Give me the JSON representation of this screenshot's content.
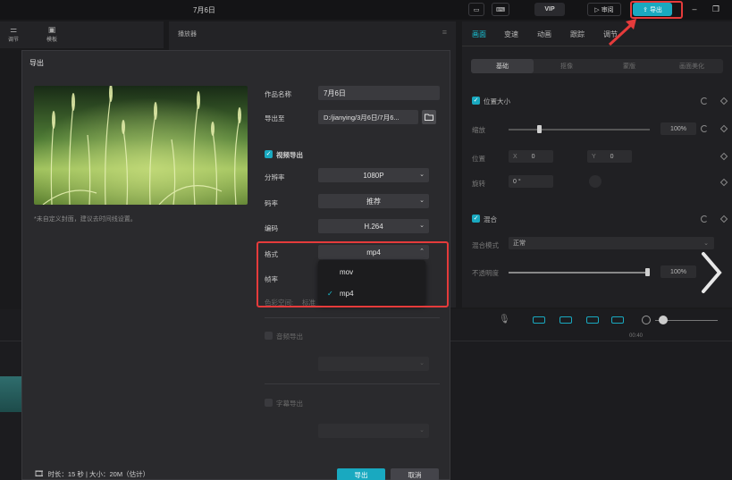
{
  "app": {
    "title": "7月6日",
    "topbar": {
      "review_label": "审阅",
      "export_label": "导出",
      "vip_label": "VIP"
    }
  },
  "left_panel": {
    "items": [
      "调节",
      "模板"
    ]
  },
  "player": {
    "title": "播放器"
  },
  "right_panel": {
    "tabs": [
      "画面",
      "变速",
      "动画",
      "跟踪",
      "调节"
    ],
    "active_tab": "画面",
    "subtabs": [
      "基础",
      "抠像",
      "蒙版",
      "画面美化"
    ],
    "position_size_label": "位置大小",
    "scale_label": "缩放",
    "scale_value": "100%",
    "position_label": "位置",
    "position_x_label": "X",
    "position_x": "0",
    "position_y_label": "Y",
    "position_y": "0",
    "rotate_label": "旋转",
    "rotate_value": "0 °",
    "blend_label": "混合",
    "blend_mode_label": "混合模式",
    "blend_mode_value": "正常",
    "opacity_label": "不透明度",
    "opacity_value": "100%"
  },
  "timeline": {
    "time_label": "00:40"
  },
  "dialog": {
    "title": "导出",
    "cover_note": "*未自定义封面，建议去时间线设置。",
    "name_label": "作品名称",
    "name_value": "7月6日",
    "export_to_label": "导出至",
    "export_to_value": "D:/jianying/3月6日/7月6...",
    "video_export_label": "视频导出",
    "resolution_label": "分辨率",
    "resolution_value": "1080P",
    "bitrate_label": "码率",
    "bitrate_value": "推荐",
    "codec_label": "编码",
    "codec_value": "H.264",
    "format_label": "格式",
    "format_value": "mp4",
    "framerate_label": "帧率",
    "colorspace_label": "色彩空间:",
    "colorspace_value": "标准",
    "format_options": [
      "mov",
      "mp4"
    ],
    "selected_format": "mp4",
    "audio_export_label": "音频导出",
    "subtitle_export_label": "字幕导出",
    "footer_info": "时长：15 秒 | 大小：20M（估计）",
    "export_button": "导出",
    "cancel_button": "取消"
  },
  "colors": {
    "accent": "#19a9c0",
    "highlight": "#e53b3b"
  }
}
